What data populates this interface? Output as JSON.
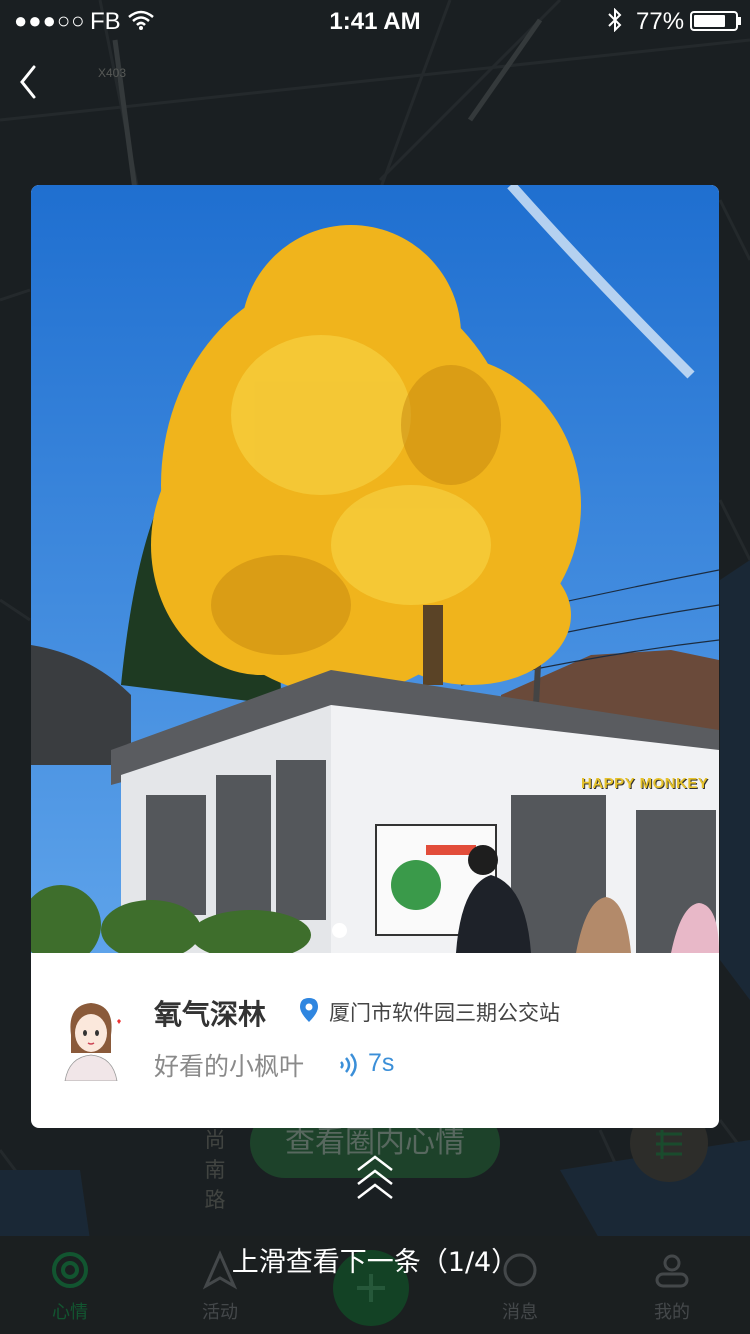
{
  "status_bar": {
    "signal": "●●●○○",
    "carrier": "FB",
    "time": "1:41 AM",
    "battery_percent": "77%",
    "battery_level": 0.77
  },
  "map": {
    "road_label_1": "X403",
    "road_name": "尚南路",
    "action_button_label": "查看圈内心情"
  },
  "card": {
    "photo": {
      "shop_sign": "HAPPY MONKEY",
      "page_indicator_count": 1
    },
    "user": {
      "name": "氧气深林",
      "location": "厦门市软件园三期公交站",
      "caption": "好看的小枫叶",
      "voice_duration": "7s"
    }
  },
  "swipe_hint": "上滑查看下一条（1/4）",
  "tab_bar": {
    "tabs": [
      {
        "label": "心情",
        "icon": "mood-icon",
        "active": true
      },
      {
        "label": "活动",
        "icon": "navigate-icon",
        "active": false
      },
      {
        "label": "消息",
        "icon": "message-icon",
        "active": false
      },
      {
        "label": "我的",
        "icon": "profile-icon",
        "active": false
      }
    ],
    "center_button_icon": "add-icon"
  }
}
